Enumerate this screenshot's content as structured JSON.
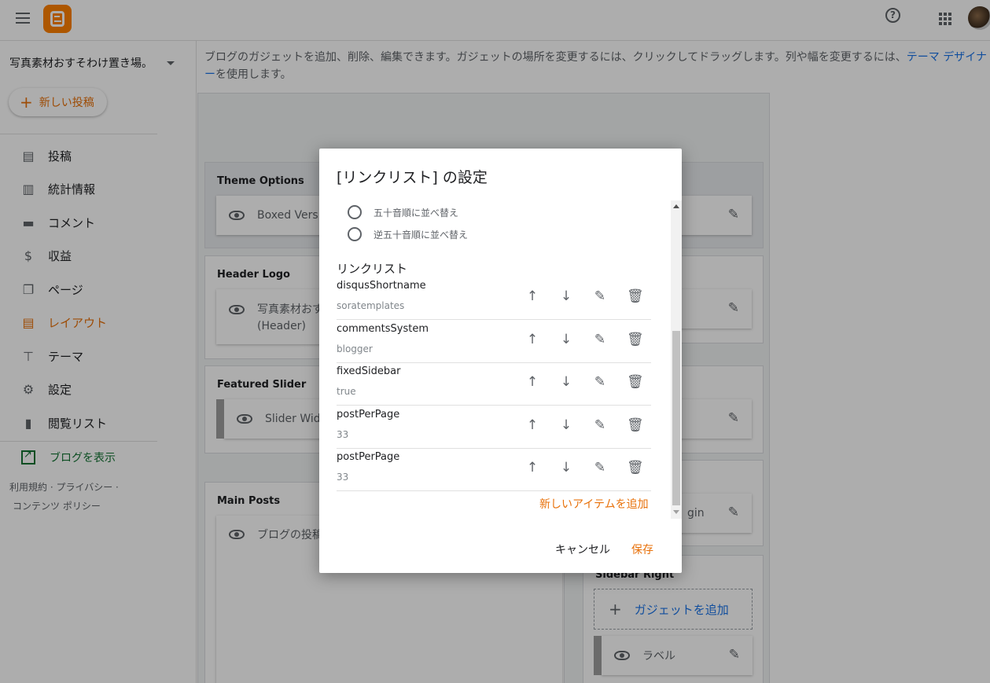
{
  "header": {
    "menu_icon": "hamburger-icon",
    "logo_icon": "blogger-logo-icon",
    "help_icon": "help-icon",
    "apps_icon": "apps-icon",
    "brand_color": "#ff8000"
  },
  "sidebar": {
    "blog_name": "写真素材おすそわけ置き場。",
    "new_post_label": "新しい投稿",
    "items": [
      {
        "label": "投稿",
        "icon": "posts-icon",
        "glyph": "▤"
      },
      {
        "label": "統計情報",
        "icon": "stats-icon",
        "glyph": "▥"
      },
      {
        "label": "コメント",
        "icon": "comment-icon",
        "glyph": "▬"
      },
      {
        "label": "収益",
        "icon": "dollar-icon",
        "glyph": "$"
      },
      {
        "label": "ページ",
        "icon": "pages-icon",
        "glyph": "❐"
      },
      {
        "label": "レイアウト",
        "icon": "layout-icon",
        "glyph": "▤"
      },
      {
        "label": "テーマ",
        "icon": "theme-icon",
        "glyph": "⊤"
      },
      {
        "label": "設定",
        "icon": "gear-icon",
        "glyph": "⚙"
      },
      {
        "label": "閲覧リスト",
        "icon": "bookmark-icon",
        "glyph": "▮"
      }
    ],
    "view_blog_label": "ブログを表示",
    "footer_line1": "利用規約 · プライバシー ·",
    "footer_line2": "コンテンツ ポリシー"
  },
  "main": {
    "info_text": "ブログのガジェットを追加、削除、編集できます。ガジェットの場所を変更するには、クリックしてドラッグします。列や幅を変更するには、",
    "info_link": "テーマ デザイナー",
    "info_suffix": "を使用します。",
    "sections": {
      "theme_options": {
        "title": "Theme Options",
        "gadget": "Boxed Version"
      },
      "header_logo": {
        "title": "Header Logo",
        "gadget_line1": "写真素材おす",
        "gadget_line2": "(Header)"
      },
      "featured_slider": {
        "title": "Featured Slider",
        "gadget": "Slider Widg"
      },
      "main_posts": {
        "title": "Main Posts",
        "gadget": "ブログの投稿"
      },
      "right_gadget_4": "gin",
      "sidebar_right": {
        "title": "Sidebar Right",
        "add_gadget": "ガジェットを追加",
        "label_gadget": "ラベル"
      }
    }
  },
  "dialog": {
    "title": "[リンクリスト] の設定",
    "sort_options": [
      "五十音順に並べ替え",
      "逆五十音順に並べ替え"
    ],
    "list_label": "リンクリスト",
    "items": [
      {
        "name": "disqusShortname",
        "value": "soratemplates"
      },
      {
        "name": "commentsSystem",
        "value": "blogger"
      },
      {
        "name": "fixedSidebar",
        "value": "true"
      },
      {
        "name": "postPerPage",
        "value": "33"
      },
      {
        "name": "postPerPage",
        "value": "33"
      }
    ],
    "add_item_label": "新しいアイテムを追加",
    "cancel_label": "キャンセル",
    "save_label": "保存",
    "accent_color": "#e8710a"
  }
}
